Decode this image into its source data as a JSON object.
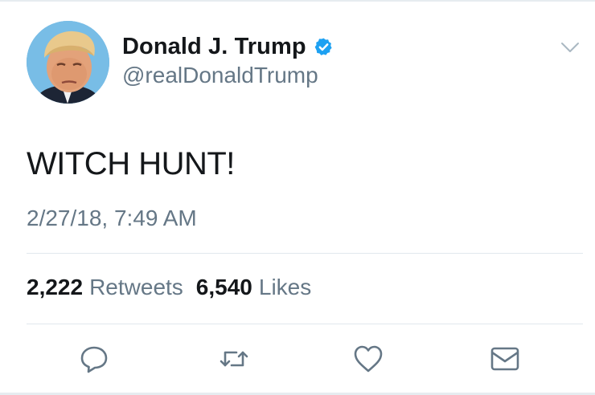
{
  "author": {
    "display_name": "Donald J. Trump",
    "handle": "@realDonaldTrump",
    "verified": true
  },
  "tweet": {
    "text": "WITCH HUNT!",
    "timestamp": "2/27/18, 7:49 AM"
  },
  "stats": {
    "retweets_count": "2,222",
    "retweets_label": "Retweets",
    "likes_count": "6,540",
    "likes_label": "Likes"
  },
  "actions": {
    "reply_icon": "reply-icon",
    "retweet_icon": "retweet-icon",
    "like_icon": "heart-icon",
    "dm_icon": "envelope-icon",
    "menu_icon": "chevron-down-icon"
  },
  "colors": {
    "text_primary": "#14171a",
    "text_secondary": "#657786",
    "verified_blue": "#1da1f2",
    "divider": "#e1e8ed"
  }
}
